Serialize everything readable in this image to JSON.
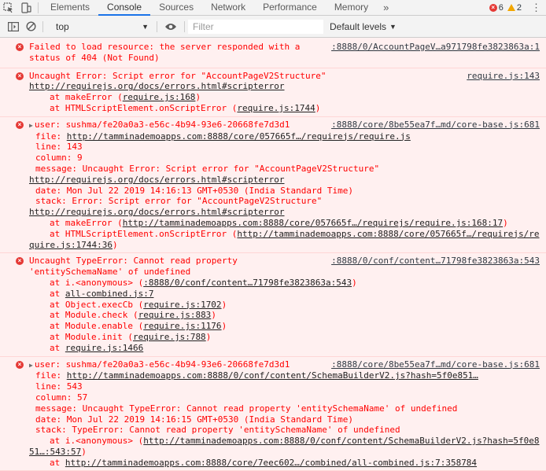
{
  "tabs": {
    "elements": "Elements",
    "console": "Console",
    "sources": "Sources",
    "network": "Network",
    "performance": "Performance",
    "memory": "Memory",
    "more": "»"
  },
  "counts": {
    "errors": "6",
    "warnings": "2"
  },
  "toolbar": {
    "context": "top",
    "filter_placeholder": "Filter",
    "levels": "Default levels"
  },
  "colors": {
    "accent": "#1a73e8",
    "error": "#ff0000",
    "error_bg": "#fff0f0"
  },
  "messages": [
    {
      "src": ":8888/0/AccountPageV…a971798fe3823863a:1",
      "lines": [
        "Failed to load resource: the server responded with a",
        "status of 404 (Not Found)"
      ]
    },
    {
      "src": "require.js:143",
      "text1": "Uncaught Error: Script error for \"AccountPageV2Structure\"",
      "link1": "http://requirejs.org/docs/errors.html#scripterror",
      "at1": "at makeError (",
      "at1link": "require.js:168",
      "at2": "at HTMLScriptElement.onScriptError (",
      "at2link": "require.js:1744"
    },
    {
      "src": ":8888/core/8be55ea7f…md/core-base.js:681",
      "user": "user: sushma/fe20a0a3-e56c-4b94-93e6-20668fe7d3d1",
      "file_key": "file: ",
      "file": "http://tamminademoapps.com:8888/core/057665f…/requirejs/require.js",
      "line": "line: 143",
      "column": "column: 9",
      "message": "message: Uncaught Error: Script error for \"AccountPageV2Structure\"",
      "message_link": "http://requirejs.org/docs/errors.html#scripterror",
      "date": "date: Mon Jul 22 2019 14:16:13 GMT+0530 (India Standard Time)",
      "stack": "stack: Error: Script error for \"AccountPageV2Structure\"",
      "stack_link": "http://requirejs.org/docs/errors.html#scripterror",
      "s1": "at makeError (",
      "s1link": "http://tamminademoapps.com:8888/core/057665f…/requirejs/require.js:168:17",
      "s2": "at HTMLScriptElement.onScriptError (",
      "s2link": "http://tamminademoapps.com:8888/core/057665f…/requirejs/re",
      "s2link2": "quire.js:1744:36"
    },
    {
      "src": ":8888/0/conf/content…71798fe3823863a:543",
      "l1": "Uncaught TypeError: Cannot read property",
      "l2": "'entitySchemaName' of undefined",
      "a1": "at i.<anonymous> (",
      "a1link": ":8888/0/conf/content…71798fe3823863a:543",
      "a2": "at ",
      "a2link": "all-combined.js:7",
      "a3": "at Object.execCb (",
      "a3link": "require.js:1702",
      "a4": "at Module.check (",
      "a4link": "require.js:883",
      "a5": "at Module.enable (",
      "a5link": "require.js:1176",
      "a6": "at Module.init (",
      "a6link": "require.js:788",
      "a7": "at ",
      "a7link": "require.js:1466"
    },
    {
      "src": ":8888/core/8be55ea7f…md/core-base.js:681",
      "user": "user: sushma/fe20a0a3-e56c-4b94-93e6-20668fe7d3d1",
      "file_key": "file: ",
      "file": "http://tamminademoapps.com:8888/0/conf/content/SchemaBuilderV2.js?hash=5f0e851…",
      "line": "line: 543",
      "column": "column: 57",
      "message": "message: Uncaught TypeError: Cannot read property 'entitySchemaName' of undefined",
      "date": "date: Mon Jul 22 2019 14:16:15 GMT+0530 (India Standard Time)",
      "stack": "stack: TypeError: Cannot read property 'entitySchemaName' of undefined",
      "s1": "at i.<anonymous> (",
      "s1link": "http://tamminademoapps.com:8888/0/conf/content/SchemaBuilderV2.js?hash=5f0e8",
      "s1link2": "51…:543:57",
      "s2": "at ",
      "s2link": "http://tamminademoapps.com:8888/core/7eec602…/combined/all-combined.js:7:358784"
    }
  ]
}
